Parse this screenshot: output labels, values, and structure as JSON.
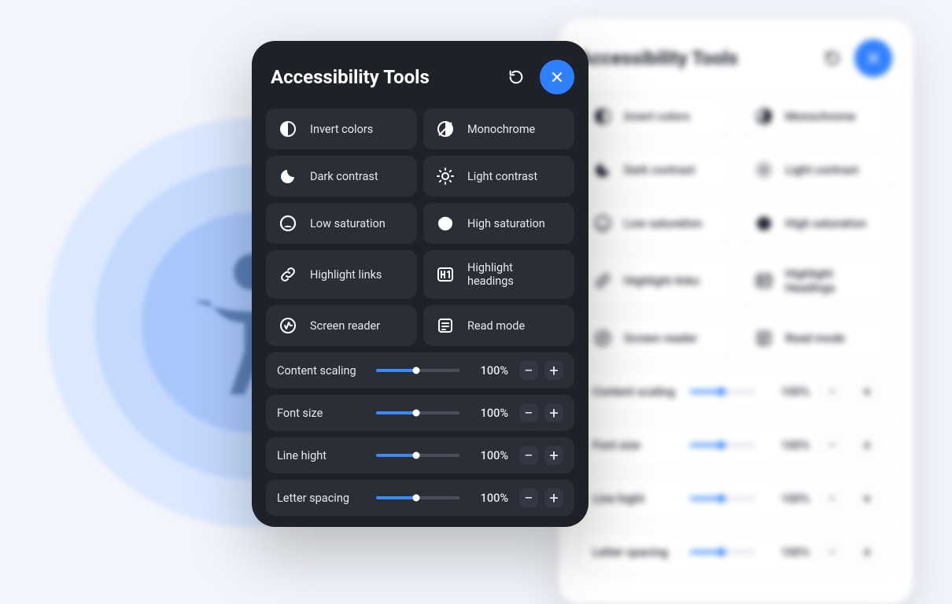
{
  "title": "Accessibility Tools",
  "light_title": "Accessibility Tools",
  "toggles": [
    {
      "label": "Invert colors",
      "icon": "invert"
    },
    {
      "label": "Monochrome",
      "icon": "monochrome"
    },
    {
      "label": "Dark contrast",
      "icon": "darkcontrast"
    },
    {
      "label": "Light contrast",
      "icon": "lightcontrast"
    },
    {
      "label": "Low saturation",
      "icon": "lowsat"
    },
    {
      "label": "High saturation",
      "icon": "highsat"
    },
    {
      "label": "Highlight links",
      "icon": "link"
    },
    {
      "label": "Highlight headings",
      "icon": "h1",
      "light_label": "Highlight Headings"
    },
    {
      "label": "Screen reader",
      "icon": "reader"
    },
    {
      "label": "Read mode",
      "icon": "readmode"
    }
  ],
  "sliders": [
    {
      "label": "Content scaling",
      "value_text": "100%",
      "fill_pct": 48
    },
    {
      "label": "Font size",
      "value_text": "100%",
      "fill_pct": 48
    },
    {
      "label": "Line hight",
      "value_text": "100%",
      "fill_pct": 48
    },
    {
      "label": "Letter spacing",
      "value_text": "100%",
      "fill_pct": 48
    }
  ]
}
